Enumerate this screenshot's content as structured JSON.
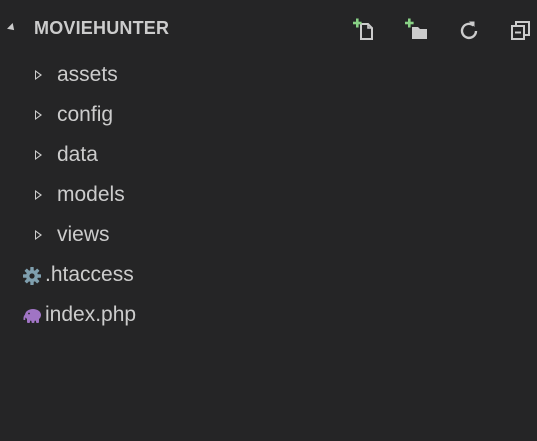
{
  "explorer": {
    "title": "MOVIEHUNTER",
    "actions": [
      {
        "name": "new-file",
        "icon": "new-file-icon"
      },
      {
        "name": "new-folder",
        "icon": "new-folder-icon"
      },
      {
        "name": "refresh",
        "icon": "refresh-icon"
      },
      {
        "name": "collapse-all",
        "icon": "collapse-all-icon"
      }
    ],
    "items": [
      {
        "label": "assets",
        "type": "folder",
        "icon": "chevron-right-icon"
      },
      {
        "label": "config",
        "type": "folder",
        "icon": "chevron-right-icon"
      },
      {
        "label": "data",
        "type": "folder",
        "icon": "chevron-right-icon"
      },
      {
        "label": "models",
        "type": "folder",
        "icon": "chevron-right-icon"
      },
      {
        "label": "views",
        "type": "folder",
        "icon": "chevron-right-icon"
      },
      {
        "label": ".htaccess",
        "type": "file",
        "icon": "gear-icon"
      },
      {
        "label": "index.php",
        "type": "file",
        "icon": "php-elephant-icon"
      }
    ],
    "colors": {
      "background": "#252526",
      "text": "#cccccc",
      "new_badge": "#89d185",
      "gear": "#7f9fae",
      "php": "#a074c4"
    }
  }
}
